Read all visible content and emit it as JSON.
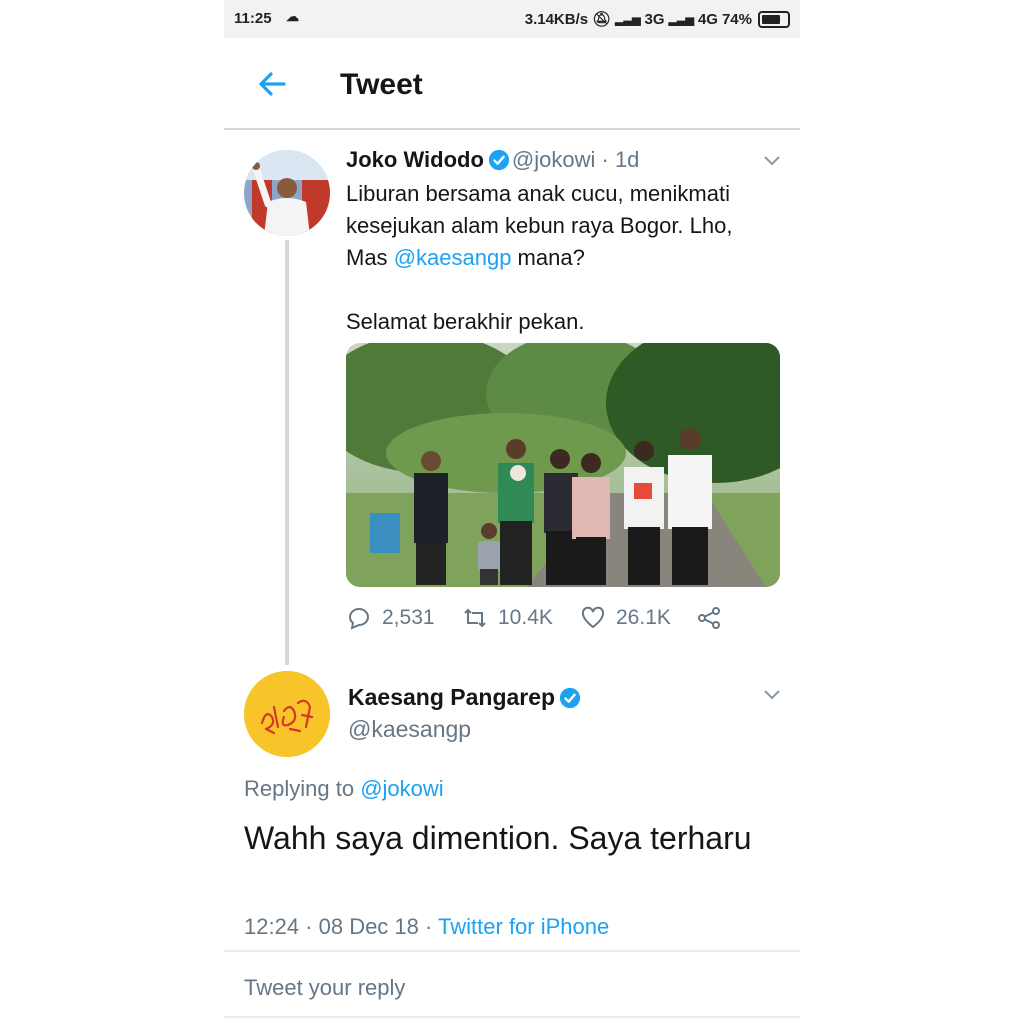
{
  "status_bar": {
    "time": "11:25",
    "speed": "3.14KB/s",
    "net1": "3G",
    "net2": "4G",
    "battery": "74%"
  },
  "header": {
    "title": "Tweet"
  },
  "tweet": {
    "name": "Joko Widodo",
    "handle": "@jokowi",
    "time": "1d",
    "line1": "Liburan bersama anak cucu, menikmati",
    "line2": "kesejukan alam kebun raya Bogor. Lho,",
    "line3_prefix": "Mas ",
    "line3_mention": "@kaesangp",
    "line3_suffix": " mana?",
    "line4": "Selamat berakhir pekan.",
    "replies": "2,531",
    "retweets": "10.4K",
    "likes": "26.1K"
  },
  "reply": {
    "name": "Kaesang Pangarep",
    "handle": "@kaesangp",
    "replying_prefix": "Replying to ",
    "replying_handle": "@jokowi",
    "text": "Wahh saya dimention. Saya terharu",
    "timestamp": "12:24 · 08 Dec 18 · ",
    "source": "Twitter for iPhone"
  },
  "composer": {
    "placeholder": "Tweet your reply"
  },
  "colors": {
    "accent": "#1da1f2",
    "muted": "#657786",
    "avatar_bg": "#f7c52a"
  },
  "icons": [
    "back-arrow-icon",
    "verified-icon",
    "chevron-down-icon",
    "reply-icon",
    "retweet-icon",
    "like-icon",
    "share-icon",
    "cloud-icon",
    "mute-icon",
    "signal-icon",
    "battery-icon"
  ]
}
